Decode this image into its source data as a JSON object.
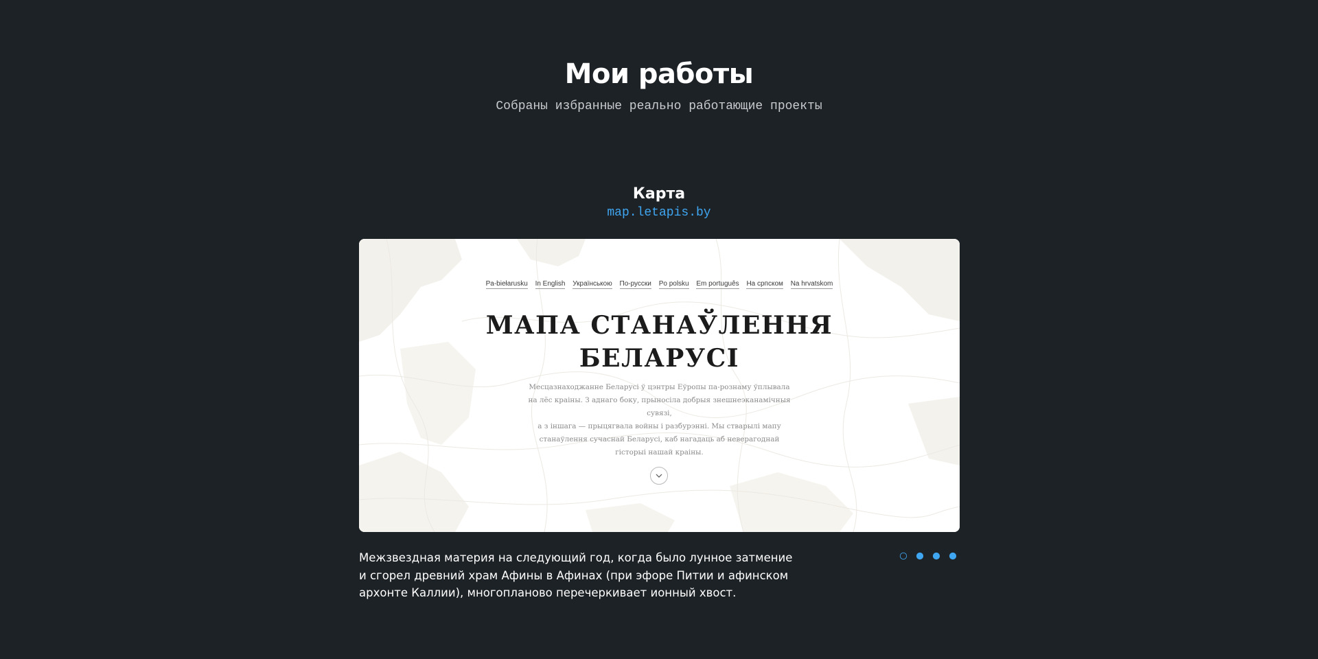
{
  "section": {
    "title": "Мои работы",
    "subtitle": "Собраны избранные реально работающие проекты"
  },
  "project": {
    "title": "Карта",
    "link": "map.letapis.by",
    "description": "Межзвездная материя на следующий год, когда было лунное затмение и сгорел древний храм Афины в Афинах (при эфоре Питии и афинском архонте Каллии), многопланово перечеркивает ионный хвост."
  },
  "preview": {
    "languages": [
      "Pa-biełarusku",
      "In English",
      "Українською",
      "По-русски",
      "Po polsku",
      "Em português",
      "На српском",
      "Na hrvatskom"
    ],
    "title_line1": "МАПА СТАНАЎЛЕННЯ",
    "title_line2": "БЕЛАРУСІ",
    "text_lines": [
      "Месцазнаходжанне Беларусі ў цэнтры Еўропы па-рознаму ўплывала",
      "на лёс краіны. З аднаго боку, прыносіла добрыя знешнеэканамічныя сувязі,",
      "а з іншага — прыцягвала войны і разбурэнні. Мы стварылі мапу",
      "станаўлення сучаснай Беларусі, каб нагадаць аб неверагоднай",
      "гісторыі нашай краіны."
    ],
    "scroll_icon": "chevron-down-icon"
  },
  "slider": {
    "total": 4,
    "active_index": 0,
    "accent_color": "#3fa6f2"
  },
  "colors": {
    "background": "#1d2226",
    "link": "#3fa6f2",
    "map_land": "#f3f1ec"
  }
}
